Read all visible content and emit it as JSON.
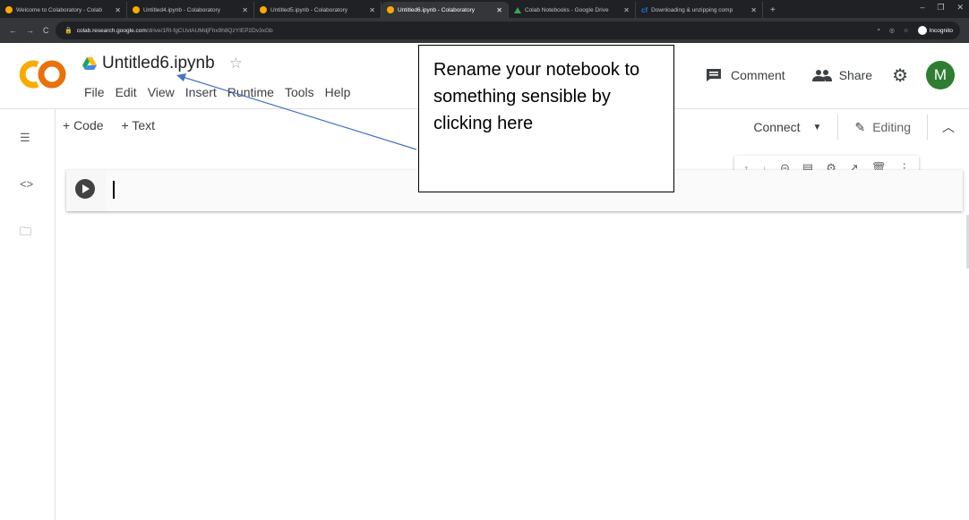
{
  "browser": {
    "tabs": [
      {
        "label": "Welcome to Colaboratory - Colab",
        "icon": "colab-icon",
        "active": false
      },
      {
        "label": "Untitled4.ipynb - Colaboratory",
        "icon": "colab-icon",
        "active": false
      },
      {
        "label": "Untitled5.ipynb - Colaboratory",
        "icon": "colab-icon",
        "active": false
      },
      {
        "label": "Untitled6.ipynb - Colaboratory",
        "icon": "colab-icon",
        "active": true
      },
      {
        "label": "Colab Notebooks - Google Drive",
        "icon": "drive-icon",
        "active": false
      },
      {
        "label": "Downloading & unzipping comp",
        "icon": "cf-icon",
        "active": false
      }
    ],
    "tab_close": "✕",
    "new_tab": "+",
    "url_host": "colab.research.google.com",
    "url_path": "/drive/1Rl-fgCUvtAUMdjFhx9h8QzYIEP2Dv3xGb",
    "incognito_label": "Incognito"
  },
  "colab": {
    "logo_text": "CO",
    "notebook_title": "Untitled6.ipynb",
    "menu": [
      "File",
      "Edit",
      "View",
      "Insert",
      "Runtime",
      "Tools",
      "Help"
    ],
    "comment_label": "Comment",
    "share_label": "Share",
    "avatar_letter": "M",
    "add_code": "+ Code",
    "add_text": "+ Text",
    "connect_label": "Connect",
    "editing_label": "Editing"
  },
  "annotation": {
    "text": "Rename your notebook to something sensible by clicking here"
  },
  "colors": {
    "colab_orange": "#f9ab00",
    "avatar_green": "#2e7d32",
    "arrow_blue": "#4472c4"
  }
}
